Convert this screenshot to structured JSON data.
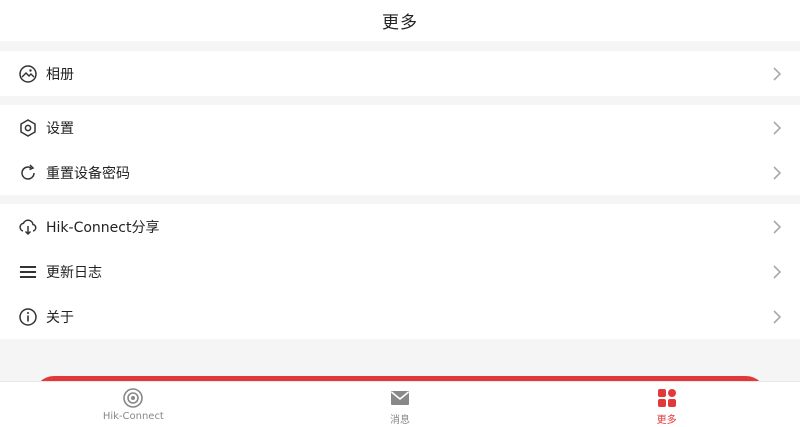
{
  "header": {
    "title": "更多"
  },
  "groups": [
    {
      "items": [
        {
          "label": "相册",
          "icon": "album-icon"
        }
      ]
    },
    {
      "items": [
        {
          "label": "设置",
          "icon": "settings-icon"
        },
        {
          "label": "重置设备密码",
          "icon": "reset-password-icon"
        }
      ]
    },
    {
      "items": [
        {
          "label": "Hik-Connect分享",
          "icon": "cloud-share-icon"
        },
        {
          "label": "更新日志",
          "icon": "list-icon"
        },
        {
          "label": "关于",
          "icon": "info-icon"
        }
      ]
    }
  ],
  "tabbar": {
    "tabs": [
      {
        "label": "Hik-Connect",
        "icon": "camera-icon",
        "active": false
      },
      {
        "label": "消息",
        "icon": "mail-icon",
        "active": false
      },
      {
        "label": "更多",
        "icon": "grid-more-icon",
        "active": true
      }
    ]
  },
  "colors": {
    "accent": "#e2383a",
    "background": "#f5f5f5",
    "surface": "#ffffff",
    "inactive": "#888888"
  }
}
